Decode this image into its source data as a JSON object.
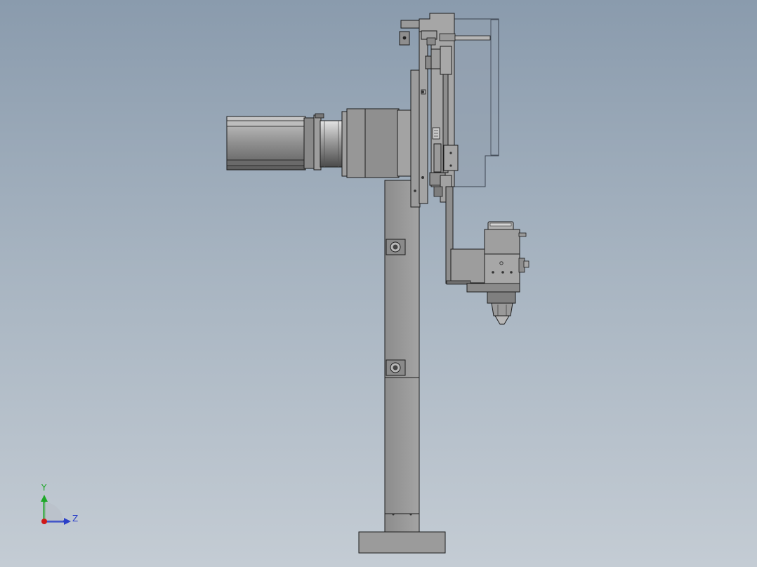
{
  "viewport": {
    "background_top": "#8a9bad",
    "background_bottom": "#c4ccd4"
  },
  "model": {
    "part_fill": "#9a9a9a",
    "part_fill_dark": "#6f6f6f",
    "part_edge": "#1c1c1c",
    "transparent_cover_fill": "#94a0ae"
  },
  "triad": {
    "y_label": "Y",
    "z_label": "Z",
    "y_color": "#1ea828",
    "z_color": "#2a3fc8",
    "x_color": "#d01818"
  }
}
